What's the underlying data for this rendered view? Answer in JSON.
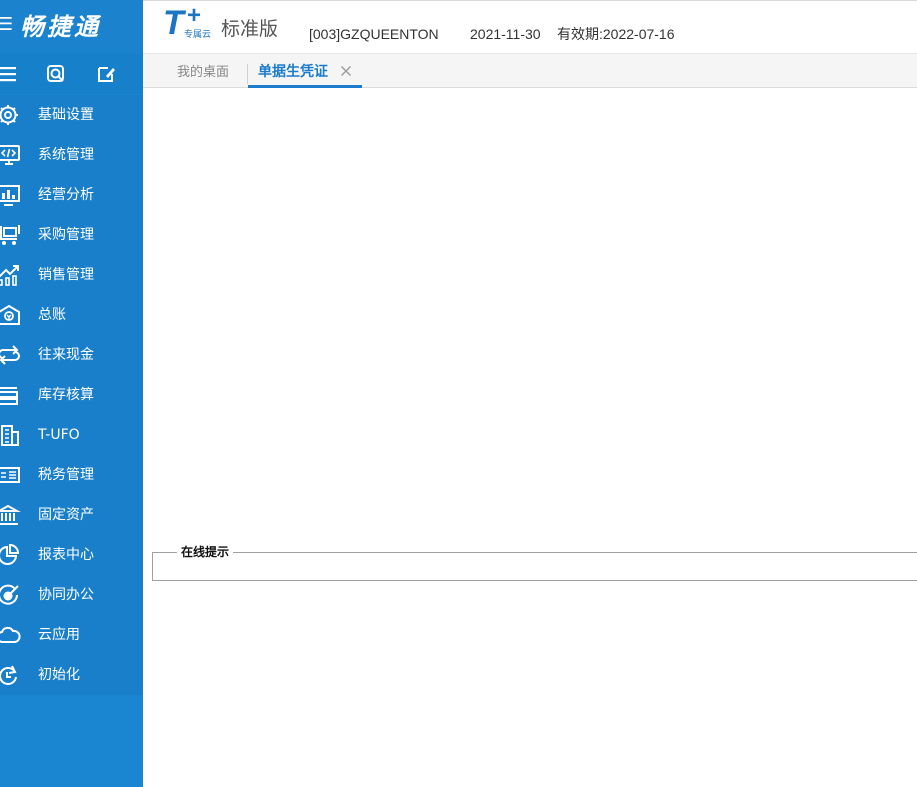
{
  "app": {
    "brand": "畅捷通",
    "brand_glyph": "☰"
  },
  "header": {
    "logo_main": "T",
    "logo_plus": "+",
    "logo_sub": "专属云",
    "edition": "标准版",
    "company": "[003]GZQUEENTON",
    "date": "2021-11-30",
    "validity": "有效期:2022-07-16"
  },
  "toolbar": {
    "icons": [
      "menu-icon",
      "search-icon",
      "edit-icon"
    ]
  },
  "sidebar": {
    "items": [
      {
        "label": "基础设置",
        "icon": "gear-icon"
      },
      {
        "label": "系统管理",
        "icon": "monitor-code-icon"
      },
      {
        "label": "经营分析",
        "icon": "bar-chart-icon"
      },
      {
        "label": "采购管理",
        "icon": "cart-icon"
      },
      {
        "label": "销售管理",
        "icon": "trend-icon"
      },
      {
        "label": "总账",
        "icon": "ledger-icon"
      },
      {
        "label": "往来现金",
        "icon": "exchange-icon"
      },
      {
        "label": "库存核算",
        "icon": "warehouse-icon"
      },
      {
        "label": "T-UFO",
        "icon": "building-icon"
      },
      {
        "label": "税务管理",
        "icon": "tax-icon"
      },
      {
        "label": "固定资产",
        "icon": "bank-icon"
      },
      {
        "label": "报表中心",
        "icon": "pie-chart-icon"
      },
      {
        "label": "协同办公",
        "icon": "target-icon"
      },
      {
        "label": "云应用",
        "icon": "cloud-icon"
      },
      {
        "label": "初始化",
        "icon": "refresh-icon"
      }
    ]
  },
  "tabs": {
    "home": "我的桌面",
    "active": "单据生凭证",
    "close_glyph": "×"
  },
  "content": {
    "tips_title": "在线提示"
  },
  "colors": {
    "sidebar": "#1a85d0",
    "accent": "#1b7ccc"
  }
}
